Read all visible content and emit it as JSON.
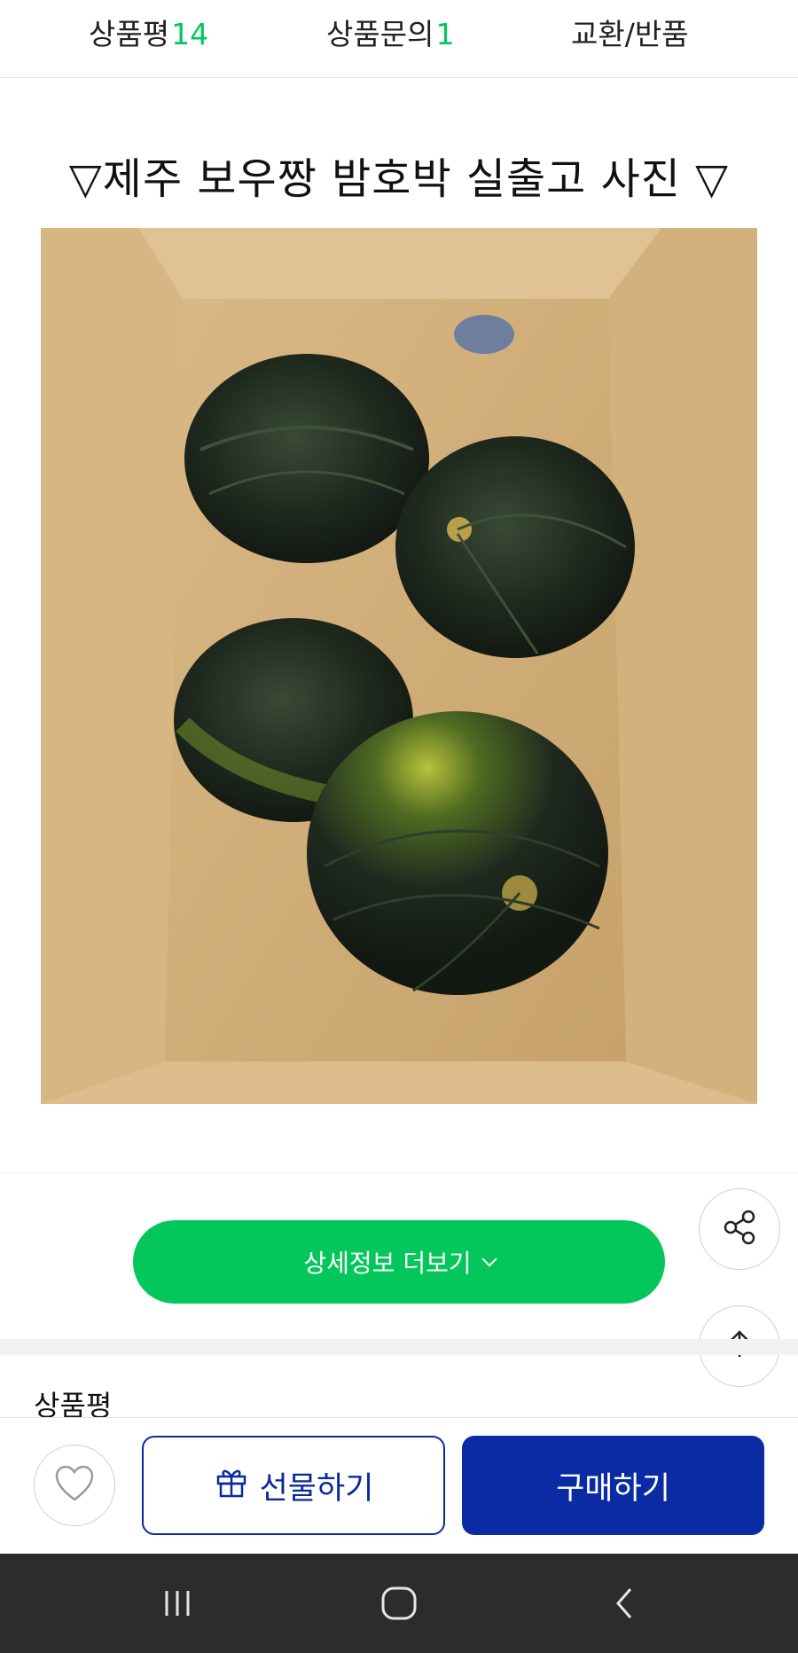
{
  "tabs": [
    {
      "label": "상품평",
      "count": "14"
    },
    {
      "label": "상품문의",
      "count": "1"
    },
    {
      "label": "교환/반품",
      "count": ""
    }
  ],
  "banner": {
    "title": "▽제주 보우짱 밤호박 실출고 사진 ▽"
  },
  "photo": {
    "subject": "Four dark green kabocha pumpkins in a cardboard box"
  },
  "more_details": {
    "label": "상세정보 더보기"
  },
  "reviews": {
    "heading": "상품평"
  },
  "actions": {
    "gift_label": "선물하기",
    "buy_label": "구매하기"
  },
  "icons": {
    "share": "share-icon",
    "top": "arrow-up-icon",
    "heart": "heart-icon",
    "gift": "gift-icon",
    "nav_recent": "recent-apps-icon",
    "nav_home": "home-icon",
    "nav_back": "back-icon"
  },
  "colors": {
    "accent_green": "#03c75a",
    "brand_blue": "#0a2ba3",
    "navbar": "#2c2c2c"
  }
}
